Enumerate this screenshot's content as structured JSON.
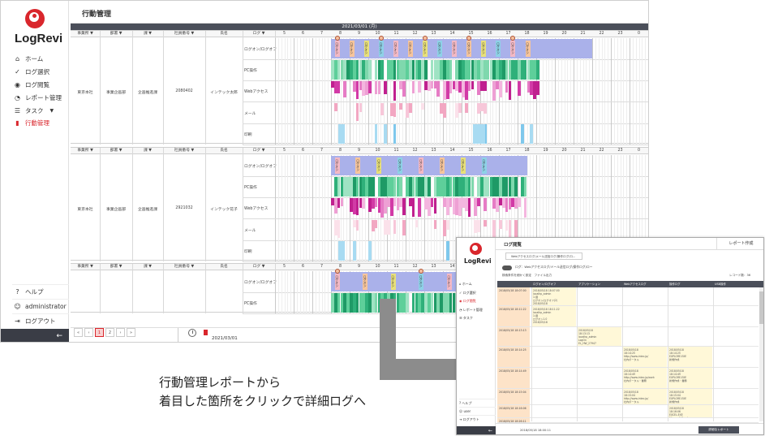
{
  "app": {
    "logo_text": "LogRevi",
    "page_title": "行動管理",
    "date_header": "2021/03/01 (月)"
  },
  "sidebar": {
    "items": [
      {
        "label": "ホーム",
        "icon": "home-icon"
      },
      {
        "label": "ログ選択",
        "icon": "check-icon"
      },
      {
        "label": "ログ閲覧",
        "icon": "eye-icon"
      },
      {
        "label": "レポート管理",
        "icon": "pie-chart-icon"
      },
      {
        "label": "タスク",
        "icon": "list-icon"
      },
      {
        "label": "行動管理",
        "icon": "activity-icon"
      }
    ],
    "bottom": [
      {
        "label": "ヘルプ",
        "icon": "help-icon"
      },
      {
        "label": "administrator",
        "icon": "user-icon"
      },
      {
        "label": "ログアウト",
        "icon": "logout-icon"
      }
    ],
    "collapse_label": "←"
  },
  "grid": {
    "columns": [
      "事業所",
      "部署",
      "課",
      "社員番号",
      "氏名",
      "ログ"
    ],
    "hours": [
      "5",
      "6",
      "7",
      "8",
      "9",
      "10",
      "11",
      "12",
      "13",
      "14",
      "15",
      "16",
      "17",
      "18",
      "19",
      "20",
      "21",
      "22",
      "23",
      "0"
    ],
    "categories": [
      "ログオン/ログオフ",
      "PC操作",
      "Webアクセス",
      "メール",
      "印刷"
    ],
    "rows": [
      {
        "office": "東京本社",
        "department": "事業企画部",
        "section": "企画推進課",
        "employee_id": "2080402",
        "name": "インテック太郎"
      },
      {
        "office": "東京本社",
        "department": "事業企画部",
        "section": "企画推進課",
        "employee_id": "2921032",
        "name": "インテック花子"
      },
      {
        "office": "",
        "department": "",
        "section": "",
        "employee_id": "",
        "name": ""
      }
    ],
    "tag_text": "ログオン"
  },
  "pager": {
    "pages": [
      "«",
      "‹",
      "1",
      "2",
      "›",
      "»"
    ],
    "active_page": "1",
    "date": "2021/03/01"
  },
  "caption": {
    "line1": "行動管理レポートから",
    "line2": "着目した箇所をクリックで詳細ログへ"
  },
  "inset": {
    "logo_text": "LogRevi",
    "title": "ログ閲覧",
    "report_tab": "レポート作成",
    "filter_text": "Webアクセスログ/メール送信ログ/操作ログ/ロ...",
    "toggle_label": "ログ：Webアクセスログ/メール送信ログ/操作ログ/ロー",
    "tools": "検索条件を細かく設定　ファイル出力",
    "count": "レコード数：36",
    "columns": [
      "ログオン/ログオフ",
      "アプリケーション",
      "Webアクセスログ",
      "操作ログ",
      "USB操作"
    ],
    "nav": [
      "ホーム",
      "ログ選択",
      "ログ閲覧",
      "レポート管理",
      "タスク"
    ],
    "bottom": [
      "ヘルプ",
      "user",
      "ログアウト"
    ],
    "rows": [
      {
        "ts": "2018/05/18 18:07:00",
        "cells": [
          "2018/05/18 18:07:00\nlocalhp_admin\n1:通\nログオン/ログオフ(2)\n2018/05/18",
          "",
          "",
          "",
          ""
        ]
      },
      {
        "ts": "2018/05/18 18:11:22",
        "cells": [
          "2018/05/18 18:11:22\nlocalhp_admin\n1:通\nログオン1.0\n2018/05/18",
          "",
          "",
          "",
          ""
        ]
      },
      {
        "ts": "2018/05/18 18:13:13",
        "cells": [
          "",
          "2018/05/18\n18:13:13\nlocalhp_admin\nLogOn\nEL_HW_27947",
          "",
          "",
          ""
        ]
      },
      {
        "ts": "2018/05/18 18:14:25",
        "cells": [
          "",
          "",
          "2018/05/18\n18:14:25\nhttp://www.intec.jp/\n社内ポータル",
          "2018/05/18\n18:14:25\nEXPLORE.EXE\n新規作成",
          ""
        ]
      },
      {
        "ts": "2018/05/18 18:14:49",
        "cells": [
          "",
          "",
          "2018/05/18\n18:14:49\nhttp://www.intec.jp/work\n社内ポータル・業務",
          "2018/05/18\n18:14:49\nEXPLORE.EXE\n新規作成・業務",
          ""
        ]
      },
      {
        "ts": "2018/05/18 18:15:04",
        "cells": [
          "",
          "",
          "2018/05/18\n18:15:04\nhttp://www.intec.jp/\n社内ポータル",
          "2018/05/18\n18:15:04\nEXPLORE.EXE\n新規作成",
          ""
        ]
      },
      {
        "ts": "2018/05/18 18:16:06",
        "cells": [
          "",
          "",
          "",
          "2018/05/18\n18:16:06\nEXCEL.EXE\nMicrosoft Excel",
          ""
        ]
      },
      {
        "ts": "2018/05/18 18:26:11",
        "cells": [
          "",
          "",
          "",
          "",
          ""
        ]
      }
    ],
    "footer_date": "2018/05/18 18:00:11",
    "footer_button": "詳細なレポート"
  }
}
